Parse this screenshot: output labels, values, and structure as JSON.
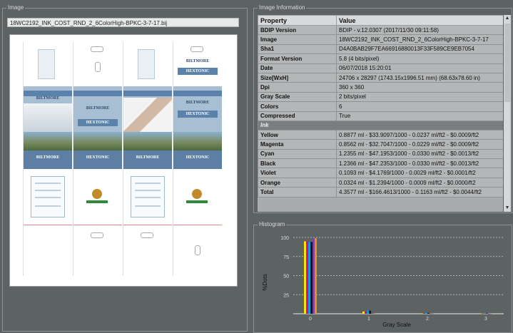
{
  "image_panel": {
    "title": "Image",
    "filename": "18WC2192_INK_COST_RND_2_6ColorHigh-BPKC-3-7-17.bij",
    "brand": "BILTMORE",
    "product": "HEXTONIC"
  },
  "info_panel": {
    "title": "Image Information",
    "columns": [
      "Property",
      "Value"
    ],
    "rows": [
      {
        "key": "BDIP Version",
        "value": "BDIP - v.12.0307 (2017/11/30 09:11:58)"
      },
      {
        "key": "Image",
        "value": "18WC2192_INK_COST_RND_2_6ColorHigh-BPKC-3-7-17"
      },
      {
        "key": "Sha1",
        "value": "D4A0BAB29F7EA66916880013F33F589CE9EB7054"
      },
      {
        "key": "Format Version",
        "value": "5.8 (4 bits/pixel)"
      },
      {
        "key": "Date",
        "value": "06/07/2018 15:20:01"
      },
      {
        "key": "Size[WxH]",
        "value": "24706 x 28297 (1743.15x1996.51 mm) (68.63x78.60 in)"
      },
      {
        "key": "Dpi",
        "value": "360 x 360"
      },
      {
        "key": "Gray Scale",
        "value": "2 bits/pixel"
      },
      {
        "key": "Colors",
        "value": "6"
      },
      {
        "key": "Compressed",
        "value": "True"
      }
    ],
    "ink_section": "Ink",
    "ink_rows": [
      {
        "key": "Yellow",
        "value": "0.8877 ml - $33.9097/1000 - 0.0237 ml/ft2 - $0.0009/ft2"
      },
      {
        "key": "Magenta",
        "value": "0.8562 ml - $32.7047/1000 - 0.0229 ml/ft2 - $0.0009/ft2"
      },
      {
        "key": "Cyan",
        "value": "1.2355 ml - $47.1953/1000 - 0.0330 ml/ft2 - $0.0013/ft2"
      },
      {
        "key": "Black",
        "value": "1.2366 ml - $47.2353/1000 - 0.0330 ml/ft2 - $0.0013/ft2"
      },
      {
        "key": "Violet",
        "value": "0.1093 ml - $4.1769/1000 - 0.0029 ml/ft2 - $0.0001/ft2"
      },
      {
        "key": "Orange",
        "value": "0.0324 ml - $1.2394/1000 - 0.0009 ml/ft2 - $0.0000/ft2"
      },
      {
        "key": "Total",
        "value": "4.3577 ml - $166.4613/1000 - 0.1163 ml/ft2 - $0.0044/ft2"
      }
    ]
  },
  "histogram_panel": {
    "title": "Histogram"
  },
  "chart_data": {
    "type": "bar",
    "xlabel": "Gray Scale",
    "ylabel": "%Dots",
    "categories": [
      "0",
      "1",
      "2",
      "3"
    ],
    "ylim": [
      0,
      100
    ],
    "yticks": [
      0,
      25,
      50,
      75,
      100
    ],
    "ytick_labels": [
      "",
      "25",
      "50",
      "75",
      "100"
    ],
    "series": [
      {
        "color": "#f2e600",
        "values": [
          95,
          3,
          0.5,
          0.3
        ]
      },
      {
        "color": "#e6007e",
        "values": [
          95,
          3,
          0.5,
          0.3
        ]
      },
      {
        "color": "#00a0e0",
        "values": [
          94,
          4,
          1,
          0.5
        ]
      },
      {
        "color": "#111111",
        "values": [
          94,
          4,
          1,
          0.5
        ]
      },
      {
        "color": "#7b3fa8",
        "values": [
          99,
          0.5,
          0.3,
          0.1
        ]
      },
      {
        "color": "#f08a1c",
        "values": [
          99,
          0.5,
          0.3,
          0.1
        ]
      }
    ],
    "grid": true
  }
}
